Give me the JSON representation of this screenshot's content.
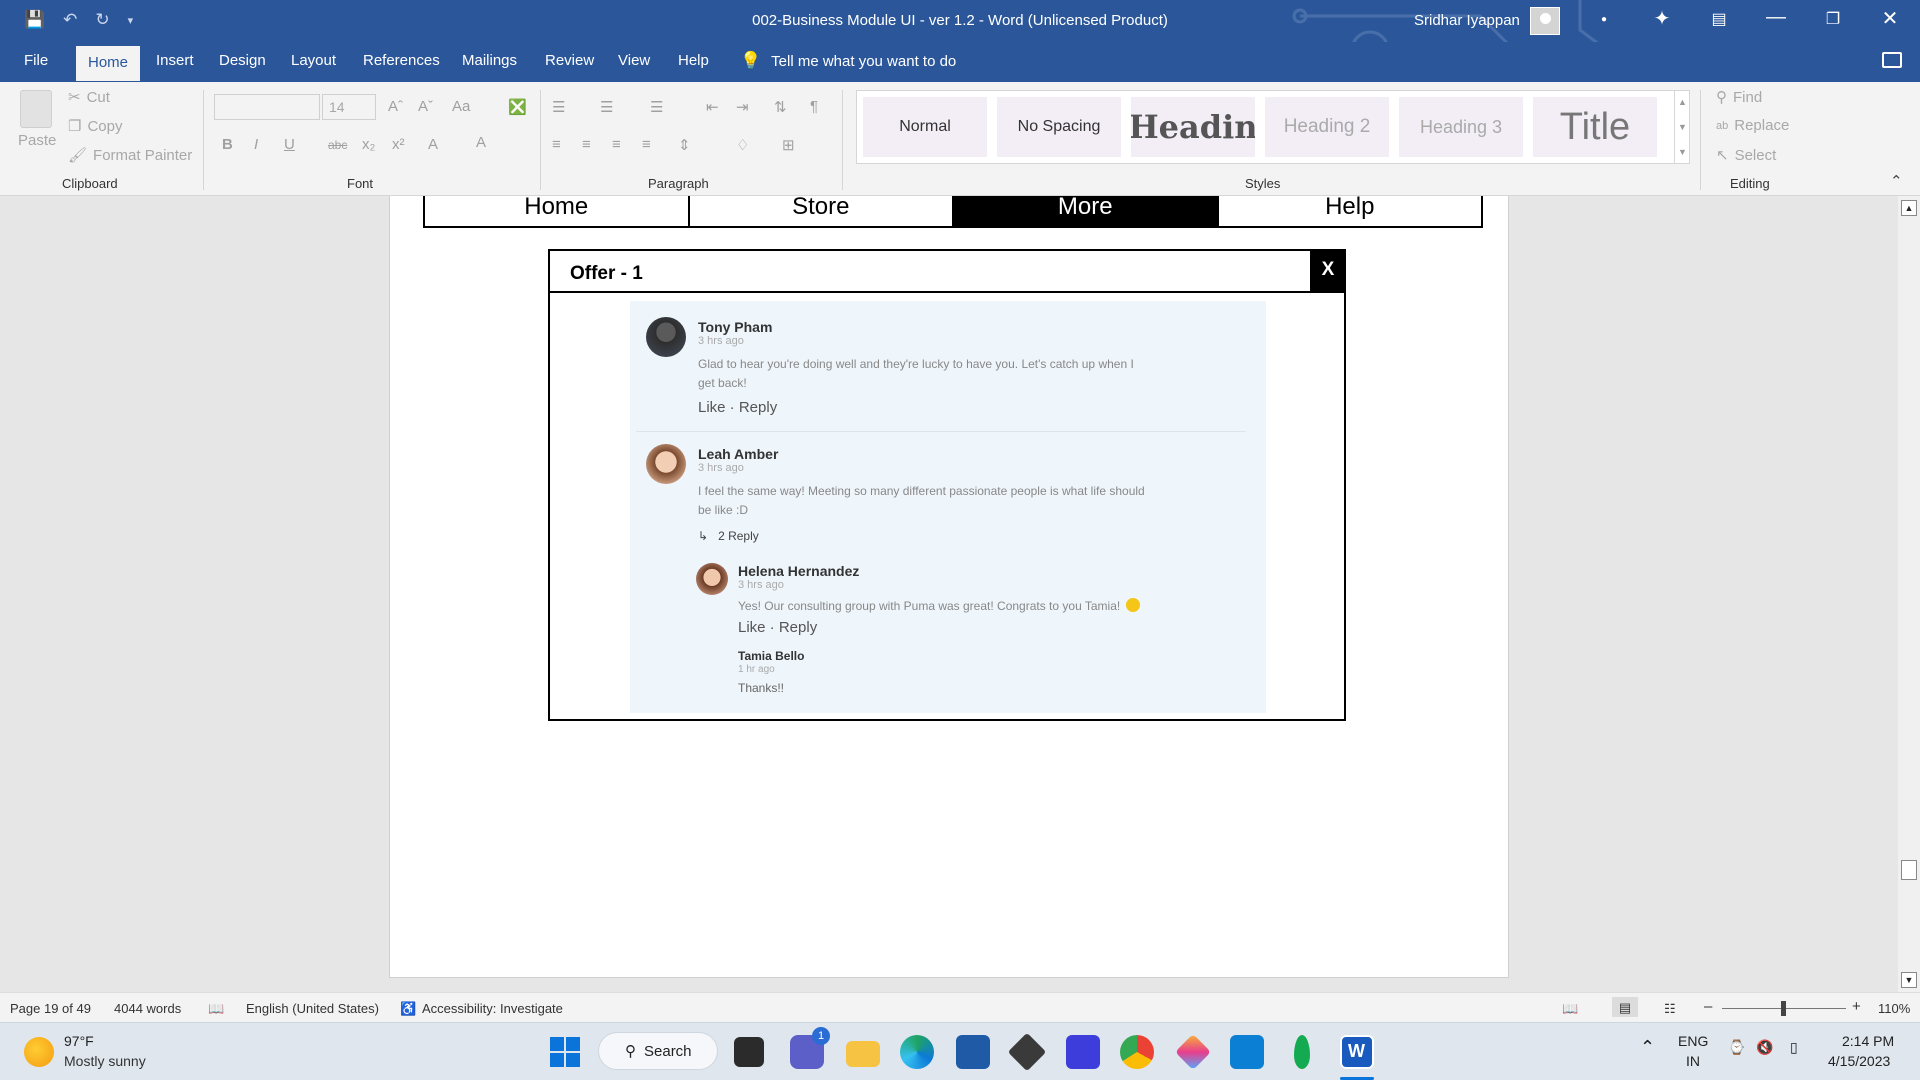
{
  "window": {
    "title": "002-Business Module UI - ver 1.2  -  Word (Unlicensed Product)",
    "user": "Sridhar Iyappan"
  },
  "menu": {
    "tabs": [
      "File",
      "Home",
      "Insert",
      "Design",
      "Layout",
      "References",
      "Mailings",
      "Review",
      "View",
      "Help"
    ],
    "active": "Home",
    "tell_me": "Tell me what you want to do"
  },
  "ribbon": {
    "clipboard": {
      "paste": "Paste",
      "cut": "Cut",
      "copy": "Copy",
      "format_painter": "Format Painter",
      "label": "Clipboard"
    },
    "font": {
      "size": "14",
      "label": "Font"
    },
    "paragraph": {
      "label": "Paragraph"
    },
    "styles": {
      "label": "Styles",
      "items": [
        "Normal",
        "No Spacing",
        "Headin",
        "Heading 2",
        "Heading 3",
        "Title"
      ]
    },
    "editing": {
      "find": "Find",
      "replace": "Replace",
      "select": "Select",
      "label": "Editing"
    }
  },
  "document": {
    "nav": [
      "Home",
      "Store",
      "More",
      "Help"
    ],
    "nav_active": "More",
    "dialog": {
      "title": "Offer - 1",
      "close": "X",
      "comments": [
        {
          "name": "Tony Pham",
          "time": "3 hrs ago",
          "text_line1": "Glad to hear you're doing well and they're lucky to have you. Let's catch up when I",
          "text_line2": "get back!",
          "actions": "Like · Reply"
        },
        {
          "name": "Leah Amber",
          "time": "3 hrs ago",
          "text_line1": "I feel the same way! Meeting so many different passionate people is what life should",
          "text_line2": "be like :D",
          "replies": "2 Reply"
        },
        {
          "name": "Helena Hernandez",
          "time": "3 hrs ago",
          "text": "Yes! Our consulting group with Puma was great! Congrats to you Tamia!",
          "actions": "Like · Reply"
        },
        {
          "name": "Tamia Bello",
          "time": "1 hr ago",
          "text": "Thanks!!"
        }
      ]
    }
  },
  "status": {
    "page": "Page 19 of 49",
    "words": "4044 words",
    "language": "English (United States)",
    "accessibility": "Accessibility: Investigate",
    "zoom": "110%"
  },
  "taskbar": {
    "temp": "97°F",
    "weather": "Mostly sunny",
    "search": "Search",
    "teams_badge": "1",
    "lang1": "ENG",
    "lang2": "IN",
    "time": "2:14 PM",
    "date": "4/15/2023"
  },
  "colors": {
    "word_blue": "#2b579a",
    "thread_bg": "#eef5fb"
  }
}
